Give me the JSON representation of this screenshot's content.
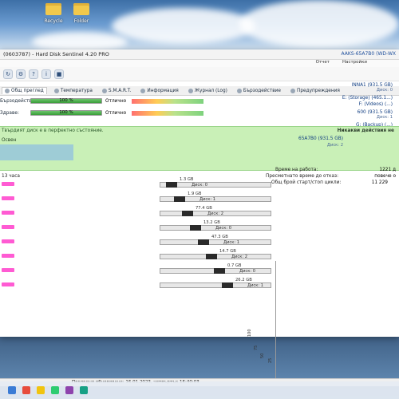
{
  "desktop": {
    "icons": [
      {
        "label": "Recycle",
        "x": 55
      },
      {
        "label": "Folder",
        "x": 90
      }
    ]
  },
  "window": {
    "title": "(0603787) - Hard Disk Sentinel 4.20 PRO",
    "title_right": "AAKS-65A7B0 (WD-WX",
    "menu": [
      "Отчет",
      "Настройки"
    ],
    "toolbar_icons": [
      "refresh-icon",
      "settings-icon",
      "help-icon",
      "info-icon"
    ]
  },
  "tabs": [
    {
      "label": "Общ преглед",
      "icon": "overview-icon"
    },
    {
      "label": "Температура",
      "icon": "thermometer-icon"
    },
    {
      "label": "S.M.A.R.T.",
      "icon": "smart-icon"
    },
    {
      "label": "Информация",
      "icon": "info-icon"
    },
    {
      "label": "Журнал (Log)",
      "icon": "log-icon"
    },
    {
      "label": "Бързодействие",
      "icon": "speed-icon"
    },
    {
      "label": "Предупреждения",
      "icon": "warning-icon"
    }
  ],
  "health": {
    "perf_label": "Бързодействие:",
    "perf_value": "100 %",
    "perf_percent": 100,
    "perf_status": "Отлично",
    "health_label": "Здраве:",
    "health_value": "100 %",
    "health_percent": 100,
    "health_status": "Отлично"
  },
  "disks": [
    {
      "name": "INNA1 (931.5 GB)",
      "sub": "Диск: 0"
    },
    {
      "name": "E: (Storage) (465.1...)",
      "sub": ""
    },
    {
      "name": "F: (Videos) (...)",
      "sub": ""
    },
    {
      "name": "600 (931.5 GB)",
      "sub": "Диск: 1"
    },
    {
      "name": "G: (Backup) (...)",
      "sub": ""
    }
  ],
  "green_panel": {
    "head": "Твърдият диск е в перфектно състояние.",
    "note": "Никакви действия не",
    "tag": "Освен",
    "disk_a": "65A7B0 (931.5 GB)",
    "disk_a_sub": "Диск: 2"
  },
  "stats": {
    "uptime_label": "Време на работа:",
    "uptime_value": "1221 д",
    "estimated_label": "Пресметнато време до отказ:",
    "estimated_value": "повече о",
    "starts_label": "Общ брой старт/стоп цикли:",
    "starts_value": "11 229",
    "hours_label": "13 часа"
  },
  "bars": [
    {
      "label": "1.3 GB",
      "val": "Диск: 0",
      "fill": 0.12
    },
    {
      "label": "1.9 GB",
      "val": "Диск: 1",
      "fill": 0.18
    },
    {
      "label": "77.4 GB",
      "val": "Диск: 2",
      "fill": 0.28
    },
    {
      "label": "13.2 GB",
      "val": "Диск: 0",
      "fill": 0.34
    },
    {
      "label": "47.3 GB",
      "val": "Диск: 1",
      "fill": 0.42
    },
    {
      "label": "14.7 GB",
      "val": "Диск: 2",
      "fill": 0.5
    },
    {
      "label": "0.7 GB",
      "val": "Диск: 0",
      "fill": 0.56
    },
    {
      "label": "26.2 GB",
      "val": "Диск: 1",
      "fill": 0.62
    }
  ],
  "footer": {
    "text": "Последно обновяване: 16.01.2023, четвъртък 16:40:03"
  },
  "axis_ticks": [
    "100",
    "75",
    "50",
    "25"
  ]
}
